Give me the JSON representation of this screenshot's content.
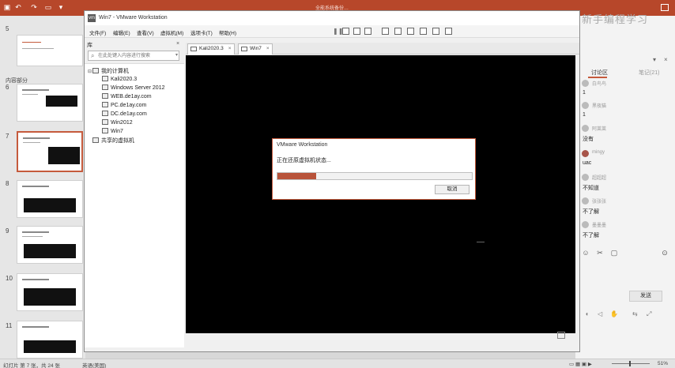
{
  "ppt": {
    "title": "全能系统备份…",
    "quick_access": [
      "save-icon",
      "undo-icon",
      "redo-icon",
      "slideshow-icon",
      "customize-icon"
    ],
    "section_label": "内容部分",
    "slide_numbers": [
      "5",
      "6",
      "7",
      "8",
      "9",
      "10",
      "11"
    ],
    "selected_slide": "7",
    "status": {
      "slide_info": "幻灯片 第 7 张，共 24 张",
      "language": "英语(美国)",
      "zoom": "51%"
    }
  },
  "side_panel": {
    "brand": "新手编程学习",
    "tabs": {
      "discuss": "讨论区",
      "notes": "笔记(21)"
    },
    "messages": [
      {
        "user": "白鸟鸟",
        "text": "1"
      },
      {
        "user": "黑夜猫",
        "text": "1"
      },
      {
        "user": "阿莱莱",
        "text": "没有"
      },
      {
        "user": "mingy",
        "text": "uac"
      },
      {
        "user": "超超超",
        "text": "不知道"
      },
      {
        "user": "张张张",
        "text": "不了解"
      },
      {
        "user": "墨墨墨",
        "text": "不了解"
      }
    ],
    "send_label": "发送"
  },
  "vmware": {
    "title": "Win7 - VMware Workstation",
    "menus": [
      "文件(F)",
      "编辑(E)",
      "查看(V)",
      "虚拟机(M)",
      "选项卡(T)",
      "帮助(H)"
    ],
    "library": {
      "title": "库",
      "search_placeholder": "在此处键入内容进行搜索",
      "root": "我的计算机",
      "vms": [
        "Kali2020.3",
        "Windows Server 2012",
        "WEB.de1ay.com",
        "PC.de1ay.com",
        "DC.de1ay.com",
        "Win2012",
        "Win7"
      ],
      "shared": "共享的虚拟机"
    },
    "tabs": [
      {
        "label": "Kali2020.3"
      },
      {
        "label": "Win7"
      }
    ],
    "dialog": {
      "title": "VMware Workstation",
      "message": "正在还原虚拟机状态...",
      "progress_percent": 20,
      "cancel_label": "取消"
    }
  }
}
